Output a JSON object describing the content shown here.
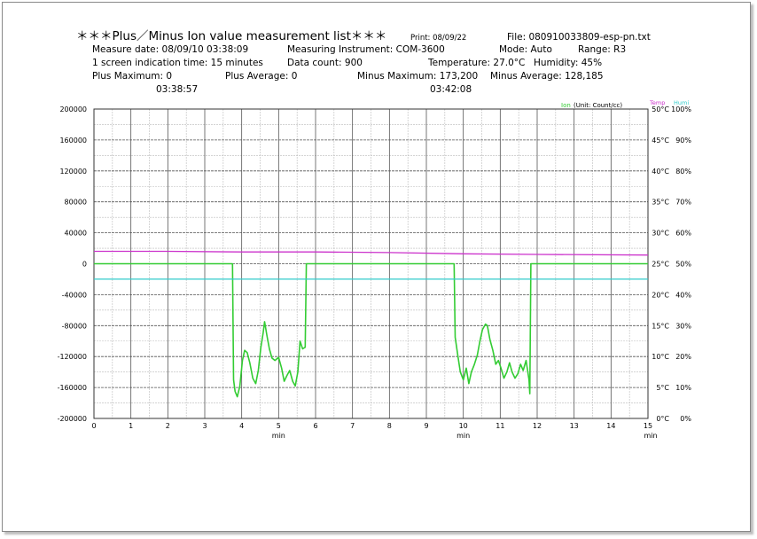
{
  "header": {
    "title": "＊＊＊Plus／Minus Ion value measurement list＊＊＊",
    "print": "Print: 08/09/22",
    "file": "File: 080910033809-esp-pn.txt",
    "measure_date": "Measure date: 08/09/10 03:38:09",
    "instrument": "Measuring Instrument: COM-3600",
    "mode": "Mode: Auto",
    "range": "Range: R3",
    "screen_time": "1 screen indication time: 15 minutes",
    "data_count": "Data count: 900",
    "temperature": "Temperature:  27.0°C",
    "humidity": "Humidity: 45%",
    "plus_max": "Plus Maximum: 0",
    "plus_max_time": "03:38:57",
    "plus_avg": "Plus Average: 0",
    "minus_max": "Minus Maximum: 173,200",
    "minus_max_time": "03:42:08",
    "minus_avg": "Minus Average: 128,185"
  },
  "chart_data": {
    "type": "line",
    "xlabel": "min",
    "xlim": [
      0,
      15
    ],
    "x_ticks": [
      "0",
      "1",
      "2",
      "3",
      "4",
      "5",
      "6",
      "7",
      "8",
      "9",
      "10",
      "11",
      "12",
      "13",
      "14",
      "15"
    ],
    "x_unit_labels": [
      {
        "at": 5,
        "text": "min"
      },
      {
        "at": 10,
        "text": "min"
      },
      {
        "at": 15,
        "text": "min"
      }
    ],
    "ylim": [
      -200000,
      200000
    ],
    "y_ticks": [
      "200000",
      "160000",
      "120000",
      "80000",
      "40000",
      "0",
      "-40000",
      "-80000",
      "-120000",
      "-160000",
      "-200000"
    ],
    "temp_ticks": [
      "50°C",
      "45°C",
      "40°C",
      "35°C",
      "30°C",
      "25°C",
      "20°C",
      "15°C",
      "10°C",
      "5°C",
      "0°C"
    ],
    "humi_ticks": [
      "100%",
      "90%",
      "80%",
      "70%",
      "60%",
      "50%",
      "40%",
      "30%",
      "20%",
      "10%",
      "0%"
    ],
    "legend": {
      "ion": "Ion",
      "unit": "(Unit: Count/cc)",
      "temp": "Temp",
      "humi": "Humi"
    },
    "colors": {
      "ion": "#33cc33",
      "temp": "#cc33cc",
      "humi": "#33cccc",
      "grid_major": "#555555",
      "grid_minor": "#bbbbbb"
    },
    "series": [
      {
        "name": "Ion",
        "color": "#33cc33",
        "points": [
          [
            0,
            0
          ],
          [
            3.75,
            0
          ],
          [
            3.78,
            -150000
          ],
          [
            3.82,
            -165000
          ],
          [
            3.88,
            -172000
          ],
          [
            3.95,
            -158000
          ],
          [
            4.02,
            -125000
          ],
          [
            4.08,
            -112000
          ],
          [
            4.15,
            -115000
          ],
          [
            4.22,
            -128000
          ],
          [
            4.3,
            -148000
          ],
          [
            4.38,
            -155000
          ],
          [
            4.45,
            -138000
          ],
          [
            4.52,
            -108000
          ],
          [
            4.58,
            -90000
          ],
          [
            4.62,
            -75000
          ],
          [
            4.68,
            -92000
          ],
          [
            4.75,
            -110000
          ],
          [
            4.82,
            -122000
          ],
          [
            4.9,
            -125000
          ],
          [
            5.0,
            -121000
          ],
          [
            5.08,
            -135000
          ],
          [
            5.15,
            -152000
          ],
          [
            5.22,
            -145000
          ],
          [
            5.3,
            -138000
          ],
          [
            5.38,
            -152000
          ],
          [
            5.45,
            -158000
          ],
          [
            5.52,
            -140000
          ],
          [
            5.58,
            -100000
          ],
          [
            5.65,
            -110000
          ],
          [
            5.72,
            -108000
          ],
          [
            5.75,
            0
          ],
          [
            9.75,
            0
          ],
          [
            9.78,
            -95000
          ],
          [
            9.85,
            -118000
          ],
          [
            9.92,
            -140000
          ],
          [
            10.0,
            -150000
          ],
          [
            10.08,
            -135000
          ],
          [
            10.15,
            -155000
          ],
          [
            10.22,
            -140000
          ],
          [
            10.3,
            -130000
          ],
          [
            10.38,
            -118000
          ],
          [
            10.45,
            -100000
          ],
          [
            10.52,
            -85000
          ],
          [
            10.6,
            -78000
          ],
          [
            10.65,
            -80000
          ],
          [
            10.72,
            -98000
          ],
          [
            10.8,
            -112000
          ],
          [
            10.88,
            -130000
          ],
          [
            10.95,
            -125000
          ],
          [
            11.02,
            -135000
          ],
          [
            11.1,
            -148000
          ],
          [
            11.18,
            -140000
          ],
          [
            11.25,
            -128000
          ],
          [
            11.32,
            -140000
          ],
          [
            11.4,
            -148000
          ],
          [
            11.48,
            -142000
          ],
          [
            11.55,
            -130000
          ],
          [
            11.62,
            -138000
          ],
          [
            11.7,
            -125000
          ],
          [
            11.78,
            -150000
          ],
          [
            11.8,
            -168000
          ],
          [
            11.83,
            0
          ],
          [
            15,
            0
          ]
        ]
      },
      {
        "name": "Temp",
        "color": "#cc33cc",
        "points": [
          [
            0,
            27.0
          ],
          [
            2,
            27.0
          ],
          [
            4,
            26.9
          ],
          [
            6,
            26.9
          ],
          [
            8,
            26.8
          ],
          [
            10,
            26.6
          ],
          [
            12,
            26.5
          ],
          [
            15,
            26.4
          ]
        ]
      },
      {
        "name": "Humi",
        "color": "#33cccc",
        "points": [
          [
            0,
            45
          ],
          [
            15,
            45
          ]
        ]
      }
    ]
  }
}
